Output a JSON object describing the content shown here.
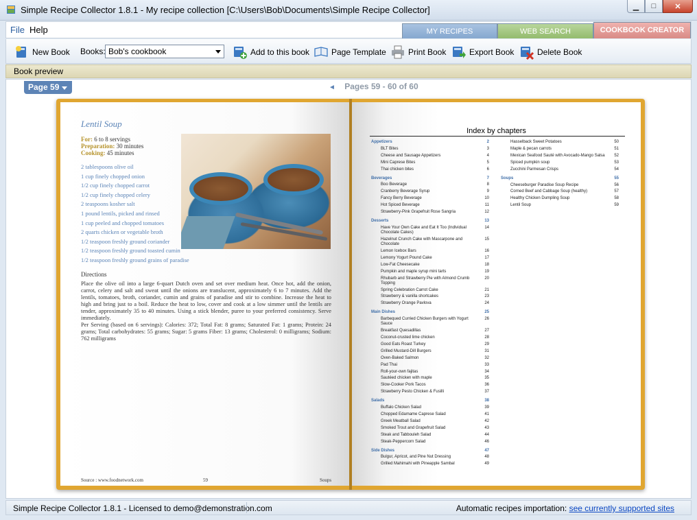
{
  "window": {
    "title": "Simple Recipe Collector 1.8.1 - My recipe collection [C:\\Users\\Bob\\Documents\\Simple Recipe Collector]",
    "min_glyph": "▁",
    "max_glyph": "□",
    "close_glyph": "✕"
  },
  "menu": {
    "file": "File",
    "help": "Help"
  },
  "tabs": {
    "my_recipes": "MY RECIPES",
    "web_search": "WEB SEARCH",
    "cookbook_creator": "COOKBOOK CREATOR"
  },
  "toolbar": {
    "new_book": "New Book",
    "books_label": "Books:",
    "books_selected": "Bob's cookbook",
    "add_to_book": "Add to this book",
    "page_template": "Page Template",
    "print_book": "Print Book",
    "export_book": "Export Book",
    "delete_book": "Delete Book"
  },
  "preview_label": "Book preview",
  "pager": {
    "current": "Page 59",
    "pages": "Pages 59 - 60 of 60",
    "prev_glyph": "◄"
  },
  "recipe": {
    "title": "Lentil Soup",
    "for_label": "For:",
    "for_value": " 6 to 8 servings",
    "prep_label": "Preparation:",
    "prep_value": " 30 minutes",
    "cook_label": "Cooking:",
    "cook_value": " 45 minutes",
    "ingredients": [
      "2 tablespoons olive oil",
      "1 cup finely chopped onion",
      "1/2 cup finely chopped carrot",
      "1/2 cup finely chopped celery",
      "2 teaspoons kosher salt",
      "1 pound lentils, picked and rinsed",
      "1 cup peeled and chopped tomatoes",
      "2 quarts chicken or vegetable broth",
      "1/2 teaspoon freshly ground coriander",
      "1/2 teaspoon freshly ground toasted cumin",
      "1/2 teaspoon freshly ground grains of paradise"
    ],
    "directions_heading": "Directions",
    "directions": "Place the olive oil into a large 6-quart Dutch oven and set over medium heat. Once hot, add the onion, carrot, celery and salt and sweat until the onions are translucent, approximately 6 to 7 minutes. Add the lentils, tomatoes, broth, coriander, cumin and grains of paradise and stir to combine. Increase the heat to high and bring just to a boil. Reduce the heat to low, cover and cook at a low simmer until the lentils are tender, approximately 35 to 40 minutes. Using a stick blender, puree to your preferred consistency. Serve immediately.",
    "serving": "Per Serving (based on 6 servings): Calories: 372; Total Fat: 8 grams; Saturated Fat: 1 grams; Protein: 24 grams; Total carbohydrates: 55 grams; Sugar: 5 grams Fiber: 13 grams; Cholesterol: 0 milligrams; Sodium: 762 milligrams",
    "footer_source": "Source : www.foodnetwork.com",
    "footer_page": "59",
    "footer_chapter": "Soups"
  },
  "index": {
    "title": "Index by chapters",
    "col1": [
      {
        "kind": "chap",
        "t": "Appetizers",
        "p": "2"
      },
      {
        "kind": "item",
        "t": "BLT Bites",
        "p": "3"
      },
      {
        "kind": "item",
        "t": "Cheese and Sausage Appetizers",
        "p": "4"
      },
      {
        "kind": "item",
        "t": "Mini Caprese Bites",
        "p": "5"
      },
      {
        "kind": "item",
        "t": "Thai chicken bites",
        "p": "6"
      },
      {
        "kind": "chap",
        "t": "Beverages",
        "p": "7"
      },
      {
        "kind": "item",
        "t": "Boo Beverage",
        "p": "8"
      },
      {
        "kind": "item",
        "t": "Cranberry Beverage Syrup",
        "p": "9"
      },
      {
        "kind": "item",
        "t": "Fancy Berry Beverage",
        "p": "10"
      },
      {
        "kind": "item",
        "t": "Hot Spiced Beverage",
        "p": "11"
      },
      {
        "kind": "item",
        "t": "Strawberry-Pink Grapefruit Rose Sangria",
        "p": "12"
      },
      {
        "kind": "chap",
        "t": "Desserts",
        "p": "13"
      },
      {
        "kind": "item two",
        "t": "Have Your Own Cake and Eat It Too (Individual Chocolate Cakes)",
        "p": "14"
      },
      {
        "kind": "item two",
        "t": "Hazelnut Crunch Cake with Mascarpone and Chocolate",
        "p": "15"
      },
      {
        "kind": "item",
        "t": "Lemon Icebox Bars",
        "p": "16"
      },
      {
        "kind": "item",
        "t": "Lemony Yogurt Pound Cake",
        "p": "17"
      },
      {
        "kind": "item",
        "t": "Low-Fat Cheesecake",
        "p": "18"
      },
      {
        "kind": "item",
        "t": "Pumpkin and maple syrup mini tarts",
        "p": "19"
      },
      {
        "kind": "item two",
        "t": "Rhubarb and Strawberry Pie with Almond Crumb Topping",
        "p": "20"
      },
      {
        "kind": "item",
        "t": "Spring Celebration Carrot Cake",
        "p": "21"
      },
      {
        "kind": "item",
        "t": "Strawberry & vanilla shortcakes",
        "p": "23"
      },
      {
        "kind": "item",
        "t": "Strawberry Orange Pavlova",
        "p": "24"
      },
      {
        "kind": "chap",
        "t": "Main Dishes",
        "p": "25"
      },
      {
        "kind": "item two",
        "t": "Barbequed Curried Chicken Burgers with Yogurt Sauce",
        "p": "26"
      },
      {
        "kind": "item",
        "t": "Breakfast Quesadillas",
        "p": "27"
      },
      {
        "kind": "item",
        "t": "Coconut-crusted lime chicken",
        "p": "28"
      },
      {
        "kind": "item",
        "t": "Good Eats Roast Turkey",
        "p": "29"
      },
      {
        "kind": "item",
        "t": "Grilled Mustard-Dill Burgers",
        "p": "31"
      },
      {
        "kind": "item",
        "t": "Oven-Baked Salmon",
        "p": "32"
      },
      {
        "kind": "item",
        "t": "Pad Thai",
        "p": "33"
      },
      {
        "kind": "item",
        "t": "Roll-your-own fajitas",
        "p": "34"
      },
      {
        "kind": "item",
        "t": "Sautéed chicken with maple",
        "p": "35"
      },
      {
        "kind": "item",
        "t": "Slow-Cooker Pork Tacos",
        "p": "36"
      },
      {
        "kind": "item",
        "t": "Strawberry Pesto Chicken & Fusilli",
        "p": "37"
      },
      {
        "kind": "chap",
        "t": "Salads",
        "p": "38"
      },
      {
        "kind": "item",
        "t": "Buffalo Chicken Salad",
        "p": "39"
      },
      {
        "kind": "item",
        "t": "Chopped Edamame Caprese Salad",
        "p": "41"
      },
      {
        "kind": "item",
        "t": "Greek Meatball Salad",
        "p": "42"
      },
      {
        "kind": "item",
        "t": "Smoked Trout and Grapefruit Salad",
        "p": "43"
      },
      {
        "kind": "item",
        "t": "Steak and Tabbouleh Salad",
        "p": "44"
      },
      {
        "kind": "item",
        "t": "Steak-Peppercorn Salad",
        "p": "46"
      },
      {
        "kind": "chap",
        "t": "Side Dishes",
        "p": "47"
      },
      {
        "kind": "item",
        "t": "Bulgur, Apricot, and Pine Nut Dressing",
        "p": "48"
      },
      {
        "kind": "item",
        "t": "Grilled Mahimahi with Pineapple Sambal",
        "p": "49"
      }
    ],
    "col2": [
      {
        "kind": "item",
        "t": "Hasselback Sweet Potatoes",
        "p": "50"
      },
      {
        "kind": "item",
        "t": "Maple & pecan carrots",
        "p": "51"
      },
      {
        "kind": "item two",
        "t": "Mexican Seafood Sauté with Avocado-Mango Salsa",
        "p": "52"
      },
      {
        "kind": "item",
        "t": "Spiced pumpkin soup",
        "p": "53"
      },
      {
        "kind": "item",
        "t": "Zucchini Parmesan Crisps",
        "p": "54"
      },
      {
        "kind": "chap",
        "t": "Soups",
        "p": "55"
      },
      {
        "kind": "item",
        "t": "Cheeseburger Paradise Soup Recipe",
        "p": "56"
      },
      {
        "kind": "item",
        "t": "Corned Beef and Cabbage Soup (healthy)",
        "p": "57"
      },
      {
        "kind": "item",
        "t": "Healthy Chicken Dumpling Soup",
        "p": "58"
      },
      {
        "kind": "item",
        "t": "Lentil Soup",
        "p": "59"
      }
    ]
  },
  "status": {
    "left": "Simple Recipe Collector 1.8.1 - Licensed to demo@demonstration.com",
    "right_label": "Automatic recipes importation: ",
    "right_link": "see currently supported sites"
  }
}
